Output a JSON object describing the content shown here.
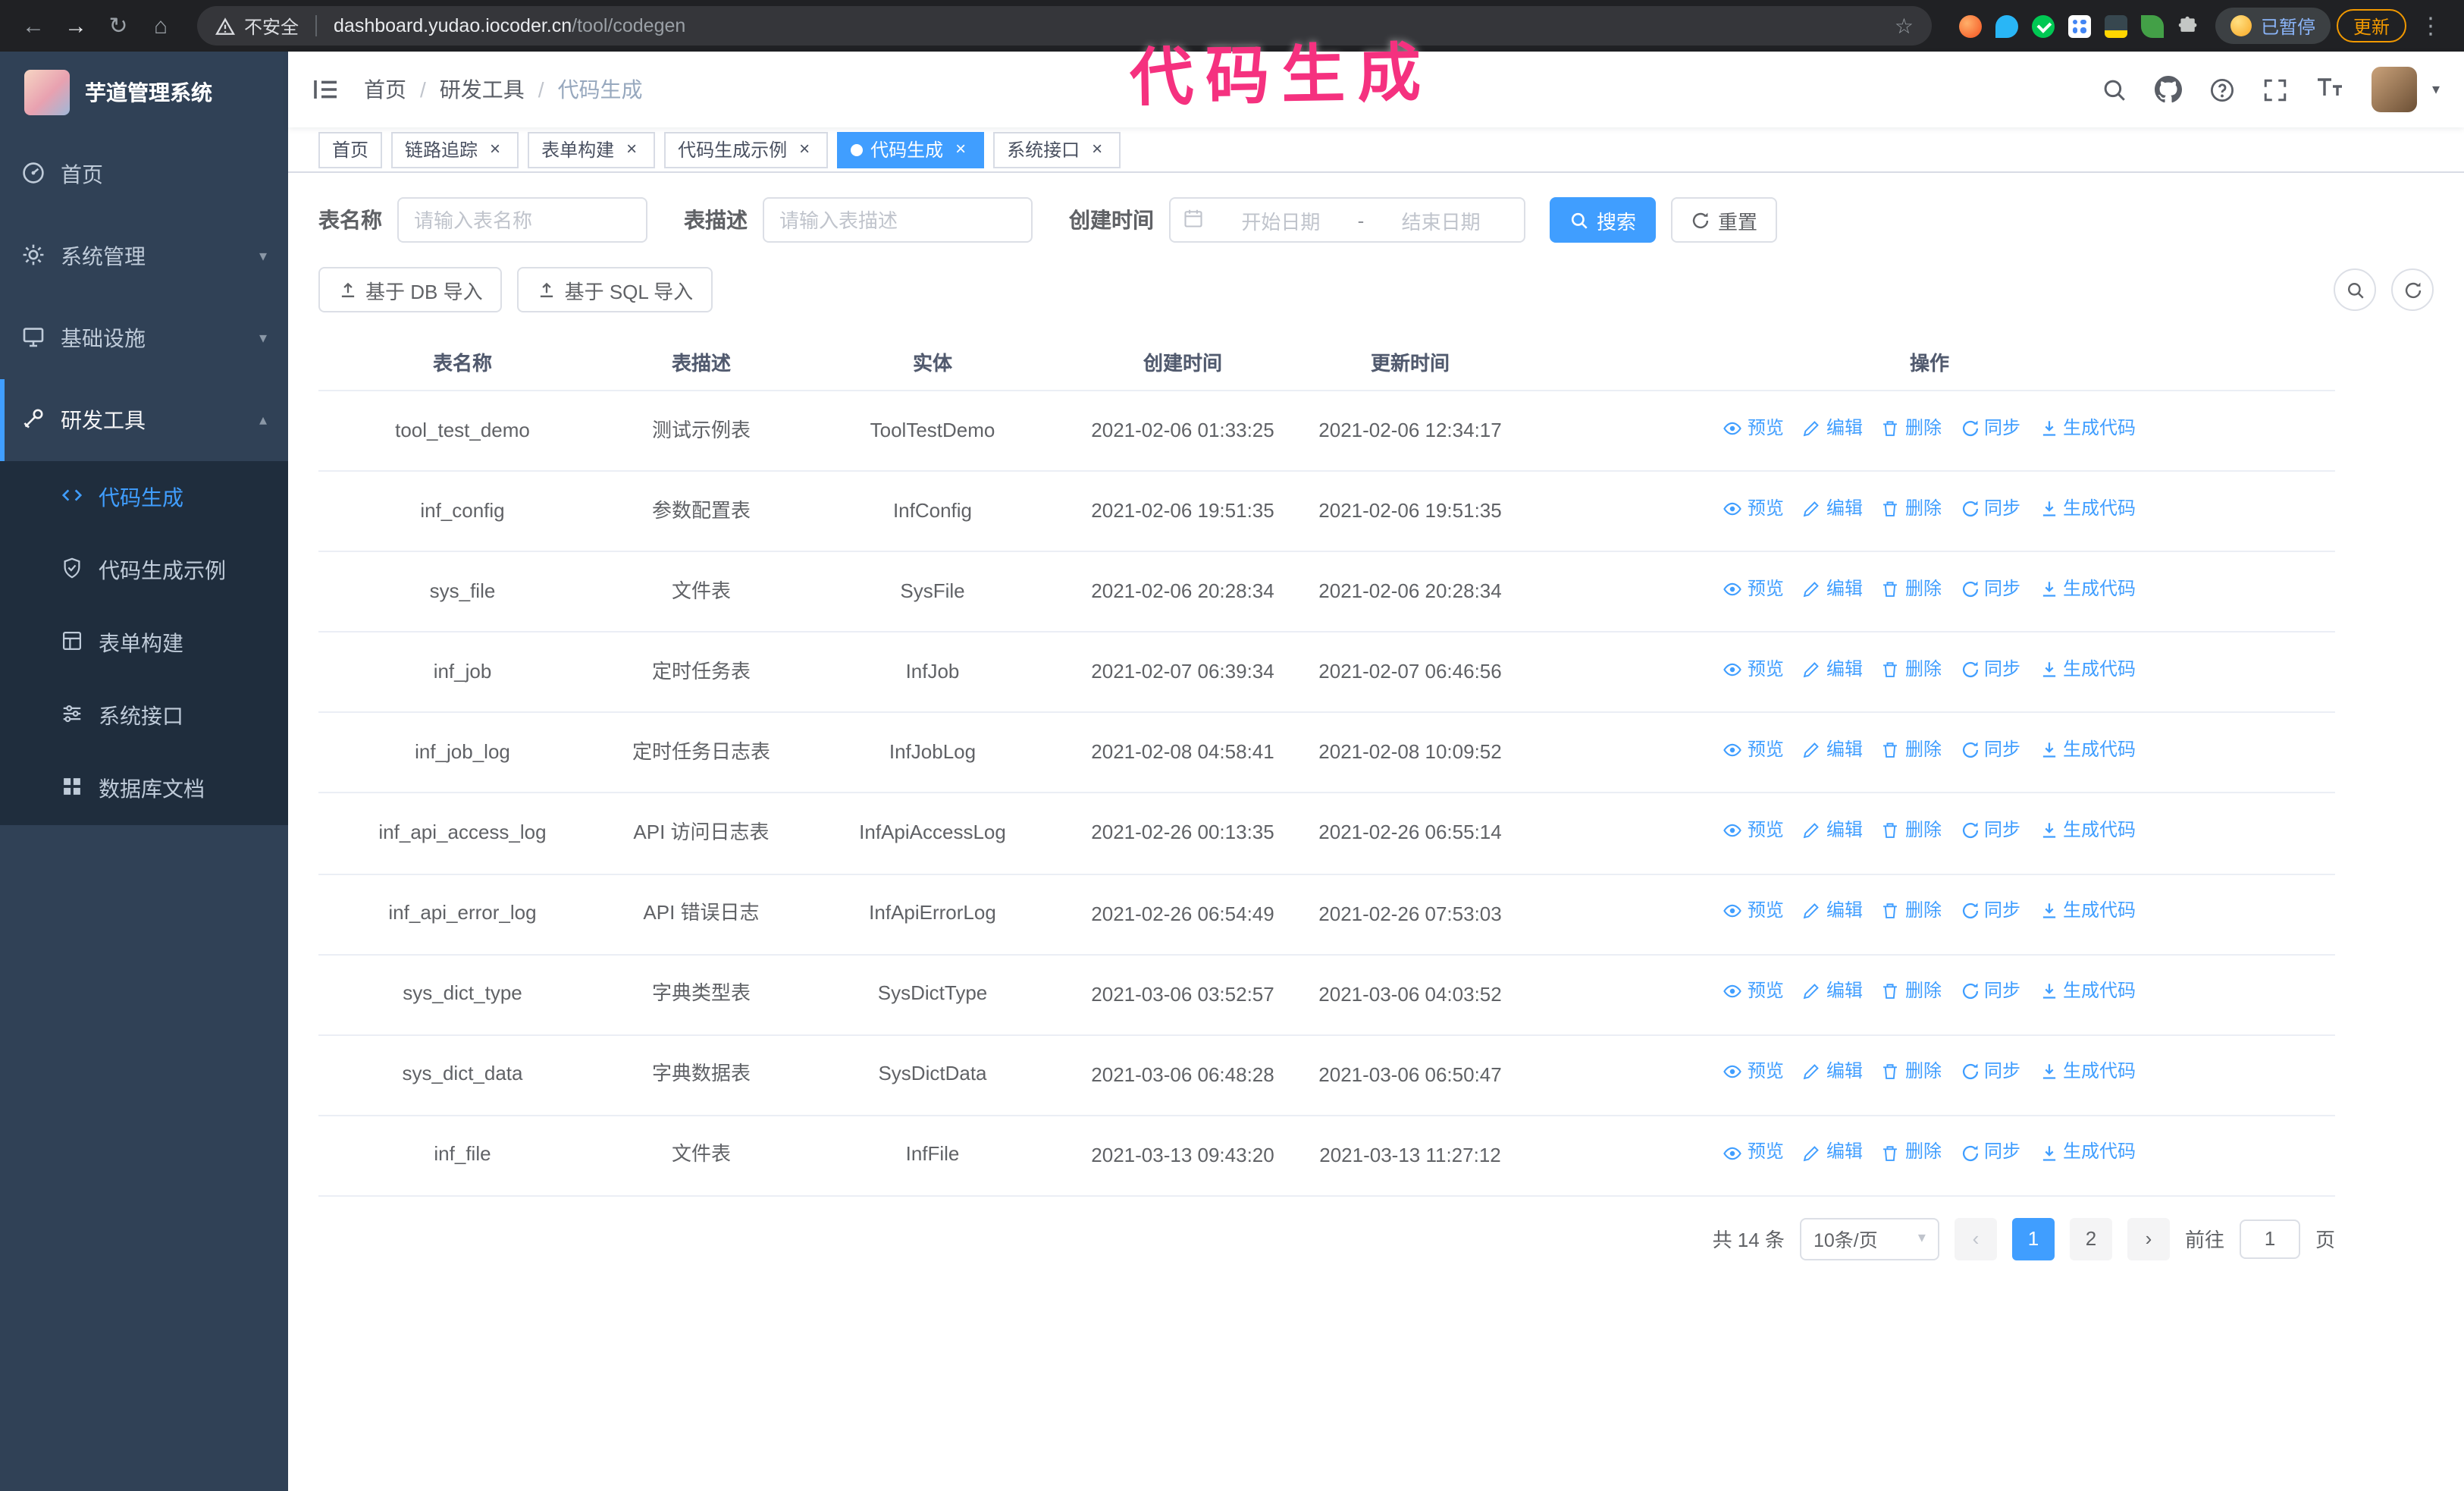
{
  "colors": {
    "accent": "#409eff",
    "annotation_pink": "#f5317f",
    "sidebar_bg": "#304156",
    "sidebar_submenu_bg": "#1f2d3d",
    "tab_active_bg": "#409eff"
  },
  "browser": {
    "security_label": "不安全",
    "url_host": "dashboard.yudao.iocoder.cn",
    "url_path": "/tool/codegen",
    "paused_badge": "已暂停",
    "update_button": "更新"
  },
  "annotation": {
    "text": "代码生成"
  },
  "sidebar": {
    "logo_title": "芋道管理系统",
    "items": [
      {
        "key": "home",
        "label": "首页"
      },
      {
        "key": "system-management",
        "label": "系统管理"
      },
      {
        "key": "infrastructure",
        "label": "基础设施"
      },
      {
        "key": "dev-tools",
        "label": "研发工具"
      }
    ],
    "sub_items": [
      {
        "key": "codegen",
        "label": "代码生成",
        "active": true
      },
      {
        "key": "codegen-example",
        "label": "代码生成示例"
      },
      {
        "key": "form-builder",
        "label": "表单构建"
      },
      {
        "key": "system-api",
        "label": "系统接口"
      },
      {
        "key": "db-doc",
        "label": "数据库文档"
      }
    ]
  },
  "header": {
    "breadcrumb": [
      "首页",
      "研发工具",
      "代码生成"
    ]
  },
  "tabs": [
    {
      "key": "home",
      "label": "首页",
      "closable": false,
      "active": false
    },
    {
      "key": "tracing",
      "label": "链路追踪",
      "closable": true,
      "active": false
    },
    {
      "key": "form-builder",
      "label": "表单构建",
      "closable": true,
      "active": false
    },
    {
      "key": "codegen-example",
      "label": "代码生成示例",
      "closable": true,
      "active": false
    },
    {
      "key": "codegen",
      "label": "代码生成",
      "closable": true,
      "active": true
    },
    {
      "key": "system-api",
      "label": "系统接口",
      "closable": true,
      "active": false
    }
  ],
  "filters": {
    "table_name_label": "表名称",
    "table_name_placeholder": "请输入表名称",
    "table_desc_label": "表描述",
    "table_desc_placeholder": "请输入表描述",
    "create_time_label": "创建时间",
    "date_start_placeholder": "开始日期",
    "date_separator": "-",
    "date_end_placeholder": "结束日期",
    "search_button": "搜索",
    "reset_button": "重置"
  },
  "toolbar": {
    "import_db_button": "基于 DB 导入",
    "import_sql_button": "基于 SQL 导入"
  },
  "table": {
    "columns": [
      "表名称",
      "表描述",
      "实体",
      "创建时间",
      "更新时间",
      "操作"
    ],
    "actions": [
      "预览",
      "编辑",
      "删除",
      "同步",
      "生成代码"
    ],
    "rows": [
      {
        "name": "tool_test_demo",
        "desc": "测试示例表",
        "entity": "ToolTestDemo",
        "created": "2021-02-06 01:33:25",
        "updated": "2021-02-06 12:34:17"
      },
      {
        "name": "inf_config",
        "desc": "参数配置表",
        "entity": "InfConfig",
        "created": "2021-02-06 19:51:35",
        "updated": "2021-02-06 19:51:35"
      },
      {
        "name": "sys_file",
        "desc": "文件表",
        "entity": "SysFile",
        "created": "2021-02-06 20:28:34",
        "updated": "2021-02-06 20:28:34"
      },
      {
        "name": "inf_job",
        "desc": "定时任务表",
        "entity": "InfJob",
        "created": "2021-02-07 06:39:34",
        "updated": "2021-02-07 06:46:56"
      },
      {
        "name": "inf_job_log",
        "desc": "定时任务日志表",
        "entity": "InfJobLog",
        "created": "2021-02-08 04:58:41",
        "updated": "2021-02-08 10:09:52"
      },
      {
        "name": "inf_api_access_log",
        "desc": "API 访问日志表",
        "entity": "InfApiAccessLog",
        "created": "2021-02-26 00:13:35",
        "updated": "2021-02-26 06:55:14"
      },
      {
        "name": "inf_api_error_log",
        "desc": "API 错误日志",
        "entity": "InfApiErrorLog",
        "created": "2021-02-26 06:54:49",
        "updated": "2021-02-26 07:53:03"
      },
      {
        "name": "sys_dict_type",
        "desc": "字典类型表",
        "entity": "SysDictType",
        "created": "2021-03-06 03:52:57",
        "updated": "2021-03-06 04:03:52"
      },
      {
        "name": "sys_dict_data",
        "desc": "字典数据表",
        "entity": "SysDictData",
        "created": "2021-03-06 06:48:28",
        "updated": "2021-03-06 06:50:47"
      },
      {
        "name": "inf_file",
        "desc": "文件表",
        "entity": "InfFile",
        "created": "2021-03-13 09:43:20",
        "updated": "2021-03-13 11:27:12"
      }
    ]
  },
  "pagination": {
    "total_text": "共 14 条",
    "page_size": "10条/页",
    "pages": [
      "1",
      "2"
    ],
    "active_page": "1",
    "goto_label": "前往",
    "goto_value": "1",
    "goto_suffix": "页"
  }
}
